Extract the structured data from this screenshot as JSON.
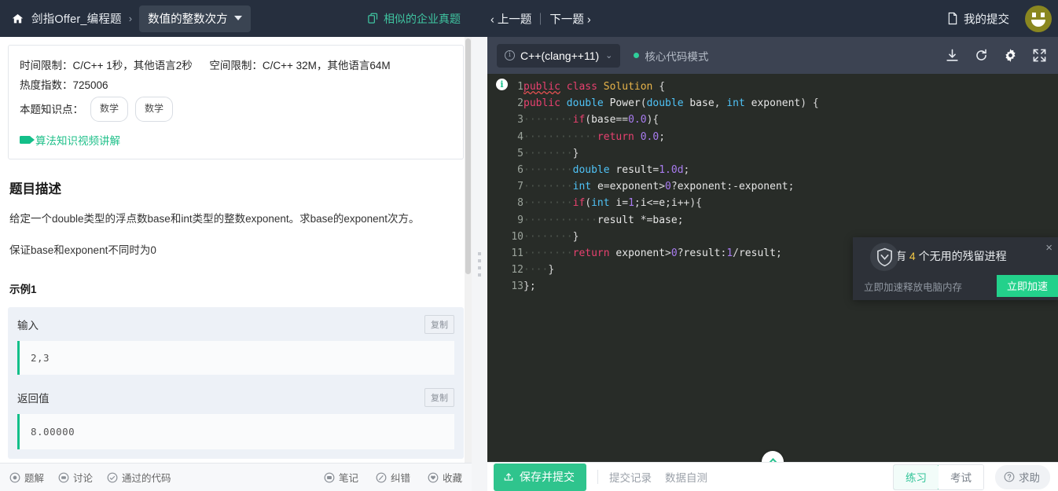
{
  "topnav": {
    "home_icon": "home-icon",
    "breadcrumb_root": "剑指Offer_编程题",
    "breadcrumb_sep": "›",
    "problem_title": "数值的整数次方",
    "similar_label": "相似的企业真题",
    "prev_label": "‹ 上一题",
    "next_label": "下一题 ›",
    "my_submissions": "我的提交"
  },
  "left": {
    "info": {
      "limits": "时间限制：C/C++ 1秒，其他语言2秒",
      "limits2": "空间限制：C/C++ 32M，其他语言64M",
      "heat": "热度指数：725006",
      "knowledge_label": "本题知识点：",
      "tags": [
        "数学",
        "数学"
      ],
      "video_link": "算法知识视频讲解"
    },
    "description": {
      "heading": "题目描述",
      "p1": "给定一个double类型的浮点数base和int类型的整数exponent。求base的exponent次方。",
      "p2": "保证base和exponent不同时为0",
      "example_heading": "示例1"
    },
    "io": [
      {
        "label": "输入",
        "copy": "复制",
        "value": "2,3"
      },
      {
        "label": "返回值",
        "copy": "复制",
        "value": "8.00000"
      }
    ],
    "footer_left": [
      {
        "label": "题解",
        "icon": "solution-icon"
      },
      {
        "label": "讨论",
        "icon": "discuss-icon"
      },
      {
        "label": "通过的代码",
        "icon": "check-circle-icon"
      }
    ],
    "footer_right": [
      {
        "label": "笔记",
        "icon": "note-icon"
      },
      {
        "label": "纠错",
        "icon": "edit-icon"
      },
      {
        "label": "收藏",
        "icon": "heart-icon"
      }
    ]
  },
  "editor": {
    "language": "C++(clang++11)",
    "mode_label": "核心代码模式",
    "toolbar_icons": [
      "download-icon",
      "reset-icon",
      "gear-icon",
      "fullscreen-icon"
    ],
    "lines": [
      {
        "n": "1",
        "html": "<span class=\"kw squig\">public</span> <span class=\"kw\">class</span> <span class=\"cls\">Solution</span> <span class=\"pn\">{</span>"
      },
      {
        "n": "2",
        "html": "<span class=\"kw\">public</span> <span class=\"typ\">double</span> <span class=\"id\">Power</span><span class=\"pn\">(</span><span class=\"typ\">double</span> <span class=\"id\">base</span><span class=\"pn\">,</span> <span class=\"typ\">int</span> <span class=\"id\">exponent</span><span class=\"pn\">)</span> <span class=\"pn\">{</span>"
      },
      {
        "n": "3",
        "html": "<span class=\"ws\">········</span><span class=\"kw\">if</span><span class=\"pn\">(</span><span class=\"id\">base</span><span class=\"pn\">==</span><span class=\"num\">0.0</span><span class=\"pn\">){</span>"
      },
      {
        "n": "4",
        "html": "<span class=\"ws\">············</span><span class=\"kw\">return</span> <span class=\"num\">0.0</span><span class=\"pn\">;</span>"
      },
      {
        "n": "5",
        "html": "<span class=\"ws\">········</span><span class=\"pn\">}</span>"
      },
      {
        "n": "6",
        "html": "<span class=\"ws\">········</span><span class=\"typ\">double</span> <span class=\"id\">result</span><span class=\"pn\">=</span><span class=\"num\">1.0d</span><span class=\"pn\">;</span>"
      },
      {
        "n": "7",
        "html": "<span class=\"ws\">········</span><span class=\"typ\">int</span> <span class=\"id\">e</span><span class=\"pn\">=</span><span class=\"id\">exponent</span><span class=\"pn\">&gt;</span><span class=\"num\">0</span><span class=\"pn\">?</span><span class=\"id\">exponent</span><span class=\"pn\">:-</span><span class=\"id\">exponent</span><span class=\"pn\">;</span>"
      },
      {
        "n": "8",
        "html": "<span class=\"ws\">········</span><span class=\"kw\">if</span><span class=\"pn\">(</span><span class=\"typ\">int</span> <span class=\"id\">i</span><span class=\"pn\">=</span><span class=\"num\">1</span><span class=\"pn\">;</span><span class=\"id\">i</span><span class=\"pn\">&lt;=</span><span class=\"id\">e</span><span class=\"pn\">;</span><span class=\"id\">i</span><span class=\"pn\">++){</span>"
      },
      {
        "n": "9",
        "html": "<span class=\"ws\">············</span><span class=\"id\">result</span> <span class=\"pn\">*=</span><span class=\"id\">base</span><span class=\"pn\">;</span>"
      },
      {
        "n": "10",
        "html": "<span class=\"ws\">········</span><span class=\"pn\">}</span>"
      },
      {
        "n": "11",
        "html": "<span class=\"ws\">········</span><span class=\"kw\">return</span> <span class=\"id\">exponent</span><span class=\"pn\">&gt;</span><span class=\"num\">0</span><span class=\"pn\">?</span><span class=\"id\">result</span><span class=\"pn\">:</span><span class=\"num\">1</span><span class=\"pn\">/</span><span class=\"id\">result</span><span class=\"pn\">;</span>"
      },
      {
        "n": "12",
        "html": "<span class=\"ws\">····</span><span class=\"pn\">}</span>"
      },
      {
        "n": "13",
        "html": "<span class=\"pn\">};</span>"
      }
    ],
    "footer": {
      "submit_label": "保存并提交",
      "links": [
        "提交记录",
        "数据自测"
      ],
      "segments": [
        {
          "label": "练习",
          "active": true
        },
        {
          "label": "考试",
          "active": false
        }
      ],
      "help_label": "求助"
    }
  },
  "toast": {
    "title_prefix": "有",
    "count": "4",
    "title_suffix": "个无用的残留进程",
    "subtitle": "立即加速释放电脑内存",
    "cta": "立即加速",
    "close": "×"
  },
  "colors": {
    "nav_bg": "#262f3e",
    "editor_bar_bg": "#3c4352",
    "code_bg": "#282c28",
    "accent_green": "#2fc48d",
    "teal_link": "#3fc4a0",
    "avatar_bg": "#8a8720",
    "toast_bg": "#2d3138",
    "toast_cta": "#23d18b",
    "count_yellow": "#f2c744"
  }
}
